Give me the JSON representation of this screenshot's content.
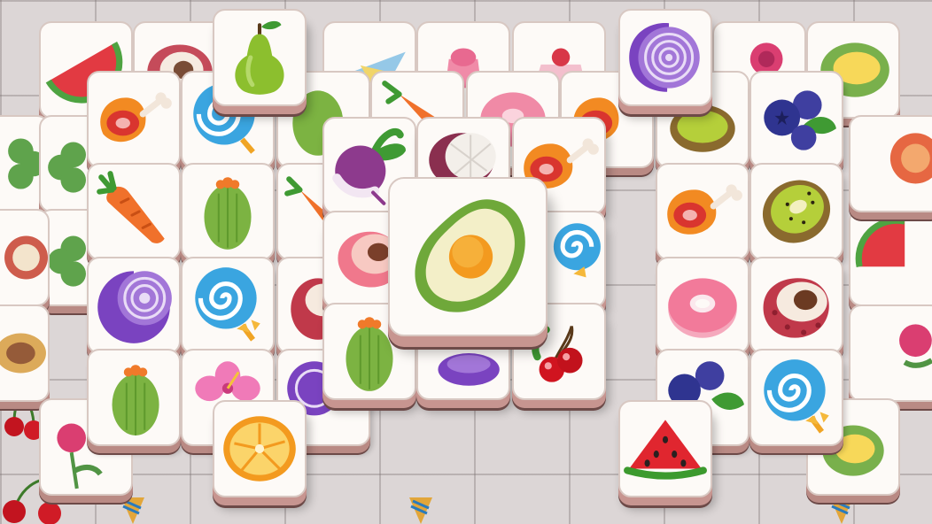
{
  "game": {
    "genre": "tile match",
    "tile_colors": {
      "face": "#fdfaf7",
      "side": "#b98a84",
      "edge": "#6d4a48"
    },
    "background_color": "#dcd6d6"
  },
  "tiles": [
    {
      "id": "t0-01",
      "icon": "watermelon"
    },
    {
      "id": "t0-02",
      "icon": "lychee"
    },
    {
      "id": "t0-03",
      "icon": "paper-plane"
    },
    {
      "id": "t0-04",
      "icon": "cake"
    },
    {
      "id": "t0-05",
      "icon": "rose"
    },
    {
      "id": "t0-06",
      "icon": "durian"
    },
    {
      "id": "t0-07",
      "icon": "clover"
    },
    {
      "id": "t0-08",
      "icon": "clover"
    },
    {
      "id": "t0-09",
      "icon": "clover"
    },
    {
      "id": "t0-10",
      "icon": "lychee"
    },
    {
      "id": "t0-11",
      "icon": "cherry"
    },
    {
      "id": "t0-12",
      "icon": "watermelon"
    },
    {
      "id": "t0-13",
      "icon": "watermelon"
    },
    {
      "id": "t0-14",
      "icon": "rose"
    },
    {
      "id": "t0-15",
      "icon": "ice-cream"
    },
    {
      "id": "t0-16",
      "icon": "ice-cream"
    },
    {
      "id": "t1-01",
      "icon": "ham"
    },
    {
      "id": "t1-02",
      "icon": "lollipop"
    },
    {
      "id": "t1-03",
      "icon": "cactus"
    },
    {
      "id": "t1-04",
      "icon": "carrot"
    },
    {
      "id": "t1-05",
      "icon": "donut"
    },
    {
      "id": "t1-06",
      "icon": "ham"
    },
    {
      "id": "t1-07",
      "icon": "kiwi"
    },
    {
      "id": "t1-08",
      "icon": "blueberry"
    },
    {
      "id": "t1-09",
      "icon": "carrot"
    },
    {
      "id": "t1-10",
      "icon": "cactus"
    },
    {
      "id": "t1-11",
      "icon": "carrot"
    },
    {
      "id": "t1-12",
      "icon": "ham"
    },
    {
      "id": "t1-13",
      "icon": "kiwi"
    },
    {
      "id": "t1-14",
      "icon": "onion"
    },
    {
      "id": "t1-15",
      "icon": "lollipop"
    },
    {
      "id": "t1-16",
      "icon": "donut"
    },
    {
      "id": "t1-17",
      "icon": "lychee"
    },
    {
      "id": "t1-18",
      "icon": "cactus"
    },
    {
      "id": "t1-19",
      "icon": "hibiscus"
    },
    {
      "id": "t1-20",
      "icon": "blueberry"
    },
    {
      "id": "t1-21",
      "icon": "lollipop"
    },
    {
      "id": "t2-01",
      "icon": "radish"
    },
    {
      "id": "t2-02",
      "icon": "mangosteen"
    },
    {
      "id": "t2-03",
      "icon": "ham"
    },
    {
      "id": "t2-04",
      "icon": "peach"
    },
    {
      "id": "t2-05",
      "icon": "lollipop"
    },
    {
      "id": "t2-06",
      "icon": "cactus"
    },
    {
      "id": "t2-07",
      "icon": "onion"
    },
    {
      "id": "t2-08",
      "icon": "cherry"
    },
    {
      "id": "t3-01",
      "icon": "pear"
    },
    {
      "id": "t3-02",
      "icon": "onion"
    },
    {
      "id": "t3-03",
      "icon": "orange"
    },
    {
      "id": "t3-04",
      "icon": "watermelon"
    },
    {
      "id": "t4-01",
      "icon": "avocado"
    }
  ]
}
